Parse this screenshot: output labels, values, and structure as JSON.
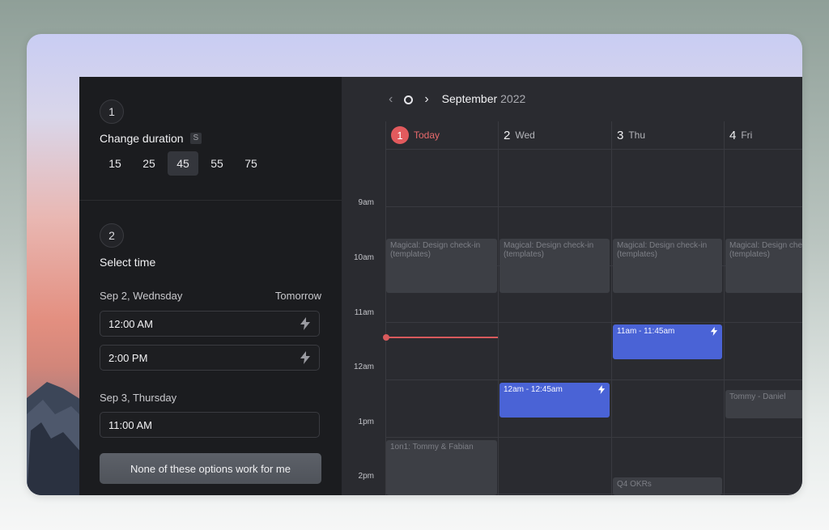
{
  "left_panel": {
    "step1": {
      "number": "1",
      "title": "Change duration",
      "shortcut": "S"
    },
    "durations": [
      "15",
      "25",
      "45",
      "55",
      "75"
    ],
    "selected_duration": "45",
    "step2": {
      "number": "2",
      "title": "Select time"
    },
    "day1": {
      "label": "Sep 2, Wednsday",
      "tag": "Tomorrow",
      "slots": [
        "12:00 AM",
        "2:00 PM"
      ]
    },
    "day2": {
      "label": "Sep 3, Thursday",
      "slots": [
        "11:00 AM"
      ]
    },
    "none_button": "None of these options work for me"
  },
  "calendar": {
    "month": "September",
    "year": "2022",
    "columns": [
      {
        "num": "1",
        "label": "Today",
        "today": true
      },
      {
        "num": "2",
        "label": "Wed",
        "today": false
      },
      {
        "num": "3",
        "label": "Thu",
        "today": false
      },
      {
        "num": "4",
        "label": "Fri",
        "today": false
      }
    ],
    "hours": [
      "9am",
      "10am",
      "11am",
      "12am",
      "1pm",
      "2pm"
    ],
    "events": [
      {
        "title": "Magical: Design check-in (templates)",
        "col": 0
      },
      {
        "title": "Magical: Design check-in (templates)",
        "col": 1
      },
      {
        "title": "Magical: Design check-in (templates)",
        "col": 2
      },
      {
        "title": "Magical: Design check-in (templates)",
        "col": 3
      },
      {
        "title": "11am - 11:45am",
        "col": 2
      },
      {
        "title": "12am - 12:45am",
        "col": 1
      },
      {
        "title": "Tommy - Daniel",
        "col": 3
      },
      {
        "title": "1on1: Tommy & Fabian",
        "col": 0
      },
      {
        "title": "Q4 OKRs",
        "col": 2
      }
    ]
  },
  "colors": {
    "accent_blue": "#4a63d6",
    "today_red": "#e25a5d"
  }
}
